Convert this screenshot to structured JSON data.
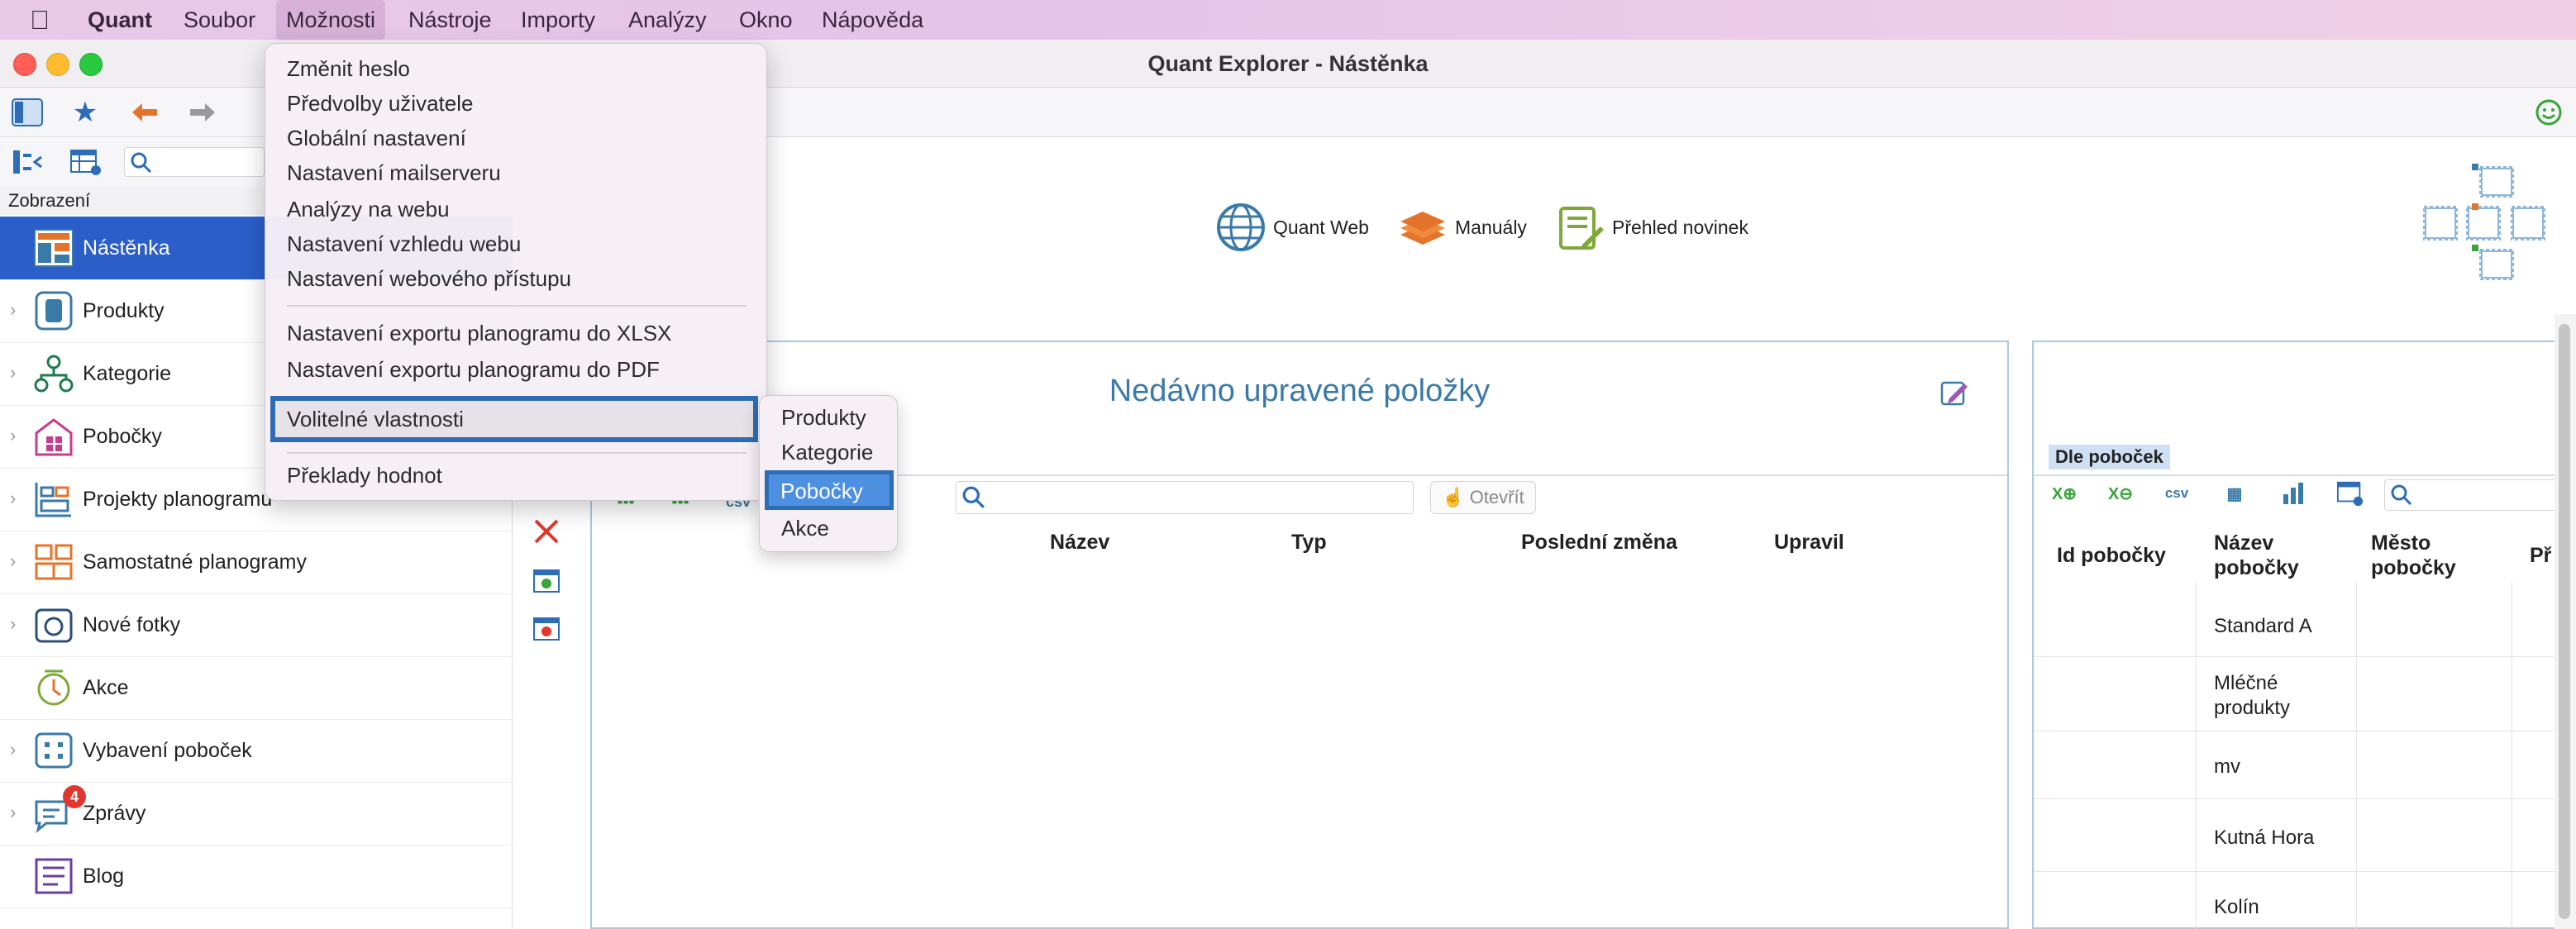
{
  "menubar": {
    "app_name": "Quant",
    "items": [
      "Soubor",
      "Možnosti",
      "Nástroje",
      "Importy",
      "Analýzy",
      "Okno",
      "Nápověda"
    ]
  },
  "window": {
    "title": "Quant Explorer - Nástěnka"
  },
  "sidebar": {
    "view_label": "Zobrazení",
    "items": [
      {
        "label": "Nástěnka",
        "icon": "dashboard-icon",
        "active": true
      },
      {
        "label": "Produkty",
        "icon": "product-icon"
      },
      {
        "label": "Kategorie",
        "icon": "category-icon"
      },
      {
        "label": "Pobočky",
        "icon": "store-icon"
      },
      {
        "label": "Projekty planogramu",
        "icon": "planogram-project-icon"
      },
      {
        "label": "Samostatné planogramy",
        "icon": "planogram-icon"
      },
      {
        "label": "Nové fotky",
        "icon": "camera-icon"
      },
      {
        "label": "Akce",
        "icon": "promo-icon"
      },
      {
        "label": "Vybavení poboček",
        "icon": "equipment-icon"
      },
      {
        "label": "Zprávy",
        "icon": "messages-icon",
        "badge": "4"
      },
      {
        "label": "Blog",
        "icon": "blog-icon"
      }
    ]
  },
  "links": {
    "quant_web": "Quant Web",
    "manuals": "Manuály",
    "news": "Přehled novinek"
  },
  "recent_panel": {
    "title": "Nedávno upravené položky",
    "csv": "csv",
    "open_button": "Otevřít",
    "columns": [
      "Název",
      "Typ",
      "Poslední změna",
      "Upravil"
    ]
  },
  "branch_panel": {
    "tab_label": "Dle poboček",
    "csv": "csv",
    "columns": [
      "Id pobočky",
      "Název pobočky",
      "Město pobočky",
      "Př"
    ],
    "rows": [
      "Standard A",
      "Mléčné produkty",
      "mv",
      "Kutná Hora",
      "Kolín"
    ]
  },
  "dropdown": {
    "group1": [
      "Změnit heslo",
      "Předvolby uživatele",
      "Globální nastavení",
      "Nastavení mailserveru",
      "Analýzy na webu",
      "Nastavení vzhledu webu",
      "Nastavení webového přístupu"
    ],
    "group2": [
      "Nastavení exportu planogramu do XLSX",
      "Nastavení exportu planogramu do PDF"
    ],
    "highlighted": "Volitelné vlastnosti",
    "last": "Překlady hodnot"
  },
  "submenu": {
    "items": [
      "Produkty",
      "Kategorie",
      "Pobočky",
      "Akce"
    ],
    "selected": "Pobočky"
  },
  "colors": {
    "accent": "#2b5ec9",
    "highlight_border": "#2e6db3",
    "panel_title": "#3a7aa9",
    "badge": "#e0382c"
  }
}
